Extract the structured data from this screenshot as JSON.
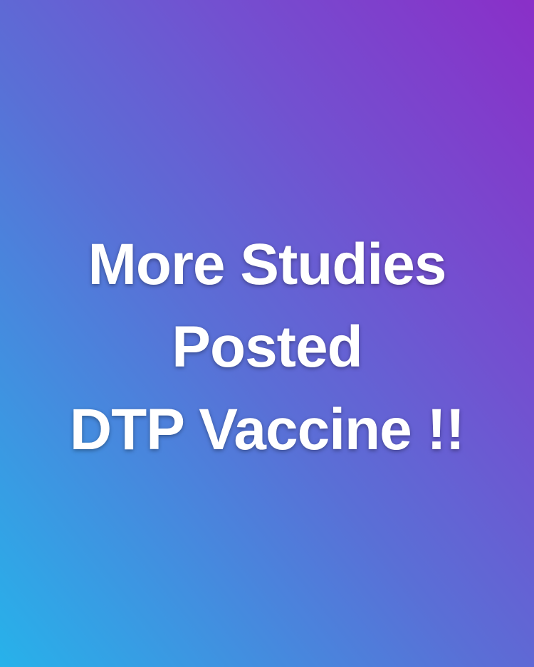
{
  "headline": {
    "lines": [
      "More Studies",
      "Posted",
      "DTP Vaccine !!"
    ]
  },
  "colors": {
    "text": "#ffffff",
    "gradient_top_right": "#8a2fc8",
    "gradient_middle": "#5a6fd6",
    "gradient_bottom_left": "#27b2ea"
  }
}
